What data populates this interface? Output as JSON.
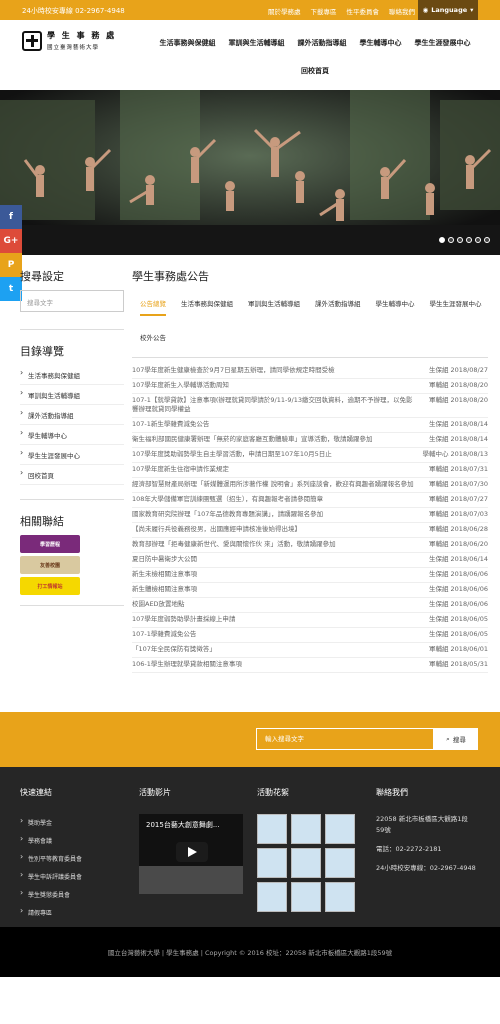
{
  "topbar": {
    "hotline": "24小時校安專線 02-2967-4948",
    "links": [
      "關於學務處",
      "下載專區",
      "性平委員會",
      "聯絡我們"
    ],
    "language": "Language"
  },
  "logo": {
    "line1": "學 生 事 務 處",
    "line2": "國立臺灣藝術大學"
  },
  "nav": [
    "生活事務與保健組",
    "軍訓與生活輔導組",
    "課外活動指導組",
    "學生輔導中心",
    "學生生涯發展中心",
    "回校首頁"
  ],
  "banner": {
    "dots": 6,
    "active_dot": 0
  },
  "social": [
    {
      "label": "f",
      "color": "#3b5998"
    },
    {
      "label": "G+",
      "color": "#dd4b39"
    },
    {
      "label": "P",
      "color": "#e8a31a"
    },
    {
      "label": "t",
      "color": "#1da1f2"
    }
  ],
  "sidebar": {
    "search_title": "搜尋設定",
    "search_placeholder": "搜尋文字",
    "nav_title": "目錄導覽",
    "nav_items": [
      "生活事務與保健組",
      "軍訓與生活輔導組",
      "課外活動指導組",
      "學生輔導中心",
      "學生生涯發展中心",
      "回校首頁"
    ],
    "related_title": "相關聯結",
    "related_links": [
      {
        "label": "學習歷程",
        "bg": "#7a2a7a",
        "fg": "#fff"
      },
      {
        "label": "友善校園",
        "bg": "#d9c9a0",
        "fg": "#6a3a1a"
      },
      {
        "label": "打工情報站",
        "bg": "#f5d800",
        "fg": "#c0392b"
      }
    ]
  },
  "content": {
    "title": "學生事務處公告",
    "tabs": [
      "公告總覽",
      "生活事務與保健組",
      "軍訓與生活輔導組",
      "課外活動指導組",
      "學生輔導中心",
      "學生生涯發展中心",
      "校外公告"
    ],
    "active_tab": "公告總覽",
    "announcements": [
      {
        "title": "107學年度新生健康檢查於9月7日星期五辦理，請同學依規定時間受檢",
        "meta": "生保組 2018/08/27"
      },
      {
        "title": "107學年度新生入學輔導活動周知",
        "meta": "軍輔組 2018/08/20"
      },
      {
        "title": "107-1【就學貸款】注意事項(辦理就貸同學請於9/11-9/13繳交回執資料，逾期不予辦理，以免影響辦理就貸同學權益",
        "meta": "軍輔組 2018/08/20"
      },
      {
        "title": "107-1新生學雜費減免公告",
        "meta": "生保組 2018/08/14"
      },
      {
        "title": "衛生福利部國民健康署辦理「無菸的家庭客廳互動體驗車」宣導活動，敬請踴躍參加",
        "meta": "生保組 2018/08/14"
      },
      {
        "title": "107學年度獎助弱勢學生自主學習活動，申請日期至107年10月5日止",
        "meta": "學輔中心 2018/08/13"
      },
      {
        "title": "107學年度新生住宿申請作業規定",
        "meta": "軍輔組 2018/07/31"
      },
      {
        "title": "經濟部智慧財產局辦理「新媒體運用所涉著作權 說明會」系列座談會，歡迎有興趣者踴躍報名參加",
        "meta": "軍輔組 2018/07/30"
      },
      {
        "title": "108年大學儲備軍官訓練團甄選（招生），有興趣報考者請參閱簡章",
        "meta": "軍輔組 2018/07/27"
      },
      {
        "title": "國家教育研究院辦理「107年品德教育專題演講」，請踴躍報名參加",
        "meta": "軍輔組 2018/07/03"
      },
      {
        "title": "【尚未履行兵役義務役男，出國應經申請核准後始得出境】",
        "meta": "軍輔組 2018/06/28"
      },
      {
        "title": "教育部辦理「拒毒健康新世代、愛與關懷作伙 來」活動，敬請踴躍參加",
        "meta": "軍輔組 2018/06/20"
      },
      {
        "title": "夏日防中暑衛步大公開",
        "meta": "生保組 2018/06/14"
      },
      {
        "title": "新生未檢相關注意事項",
        "meta": "生保組 2018/06/06"
      },
      {
        "title": "新生體檢相關注意事項",
        "meta": "生保組 2018/06/06"
      },
      {
        "title": "校園AED放置地點",
        "meta": "生保組 2018/06/06"
      },
      {
        "title": "107學年度弱勢助學計畫採線上申請",
        "meta": "生保組 2018/06/05"
      },
      {
        "title": "107-1學雜費減免公告",
        "meta": "生保組 2018/06/05"
      },
      {
        "title": "「107年全民保防有獎徵答」",
        "meta": "軍輔組 2018/06/01"
      },
      {
        "title": "106-1學生辦理就學貸款相關注意事項",
        "meta": "軍輔組 2018/05/31"
      }
    ]
  },
  "search_band": {
    "placeholder": "輸入搜尋文字",
    "button": "搜尋"
  },
  "footer": {
    "quick_title": "快速連結",
    "quick_links": [
      "獎助學金",
      "學務會議",
      "性別平等教育委員會",
      "學生申訴評議委員會",
      "學生獎懲委員會",
      "請假專區"
    ],
    "video_title": "活動影片",
    "video_caption": "2015台藝大創意舞劇...",
    "gallery_title": "活動花絮",
    "contact_title": "聯絡我們",
    "address": "22058 新北市板橋區大觀路1段59號",
    "phone": "電話：02-2272-2181",
    "hotline": "24小時校安專線：02-2967-4948"
  },
  "copyright": "國立台灣藝術大學 | 學生事務處 | Copyright © 2016 校址：22058 新北市板橋區大觀路1段59號"
}
